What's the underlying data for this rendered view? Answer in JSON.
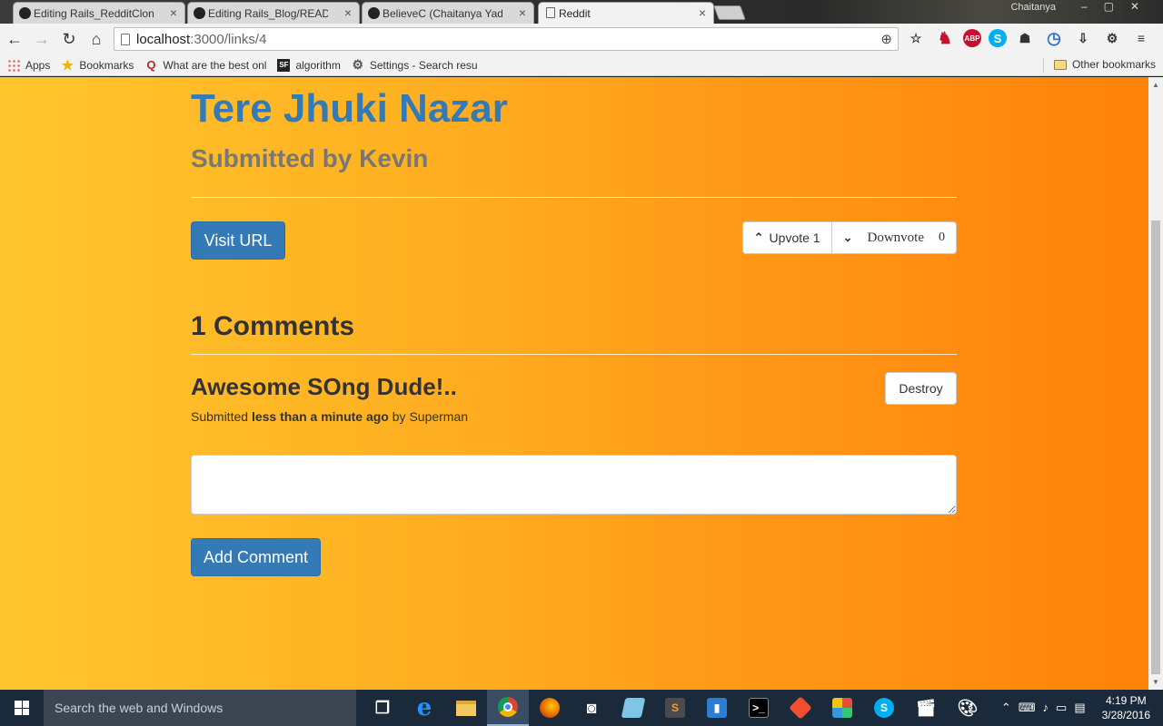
{
  "browser": {
    "tabs": [
      {
        "title": "Editing Rails_RedditClone",
        "active": false
      },
      {
        "title": "Editing Rails_Blog/READM",
        "active": false
      },
      {
        "title": "BelieveC (Chaitanya Yaday",
        "active": false
      },
      {
        "title": "Reddit",
        "active": true
      }
    ],
    "user_name": "Chaitanya",
    "url_host": "localhost",
    "url_path": ":3000/links/4",
    "bookmarks": [
      {
        "label": "Apps",
        "icon": "apps-icon"
      },
      {
        "label": "Bookmarks",
        "icon": "star-icon"
      },
      {
        "label": "What are the best onl",
        "icon": "quora-icon"
      },
      {
        "label": "algorithm",
        "icon": "sf-icon"
      },
      {
        "label": "Settings - Search resu",
        "icon": "gear-icon"
      }
    ],
    "other_bookmarks": "Other bookmarks"
  },
  "page": {
    "link_title": "Tere Jhuki Nazar",
    "submitted_by": "Submitted by Kevin",
    "visit_url_label": "Visit URL",
    "upvote_label": "Upvote 1",
    "downvote_label": "Downvote",
    "downvote_count": "0",
    "comments_heading": "1 Comments",
    "comment": {
      "body": "Awesome SOng Dude!..",
      "meta_prefix": "Submitted",
      "meta_time": "less than a minute ago",
      "meta_suffix": "by Superman",
      "destroy_label": "Destroy"
    },
    "comment_input_value": "",
    "add_comment_label": "Add Comment"
  },
  "taskbar": {
    "search_placeholder": "Search the web and Windows",
    "time": "4:19 PM",
    "date": "3/28/2016"
  },
  "colors": {
    "link_blue": "#337ab7",
    "bg_gradient_start": "#ffc52e",
    "bg_gradient_end": "#ff8209"
  }
}
